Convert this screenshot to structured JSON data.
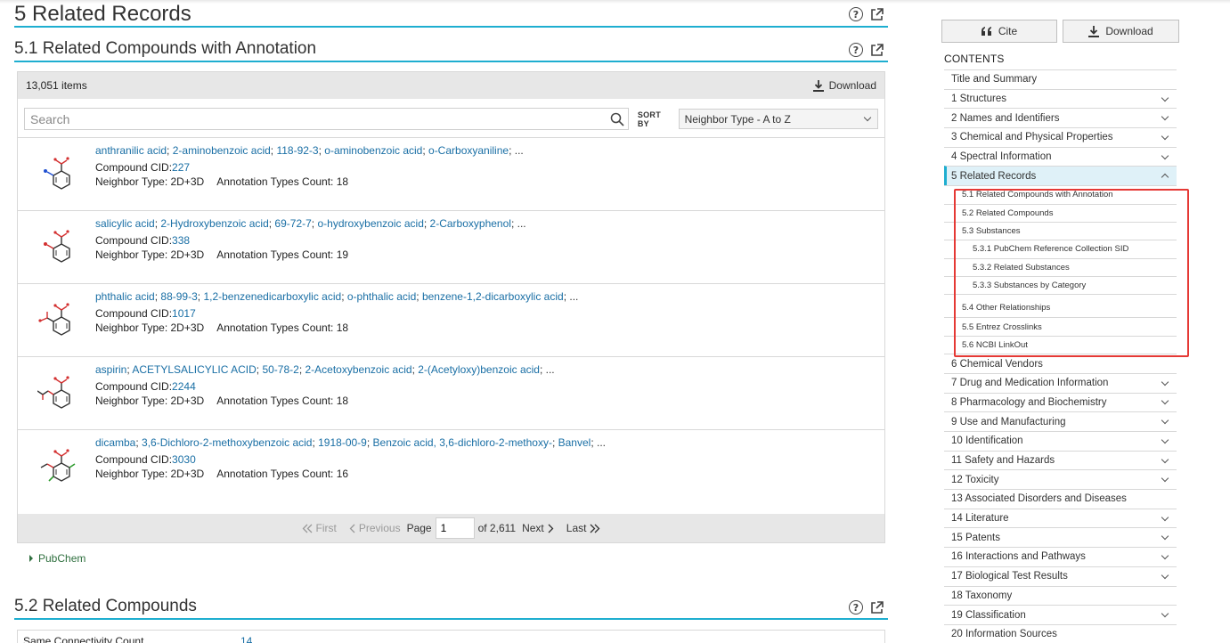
{
  "section5": {
    "title": "5 Related Records"
  },
  "section51": {
    "title": "5.1 Related Compounds with Annotation",
    "count": "13,051 items",
    "download_label": "Download",
    "search_placeholder": "Search",
    "sort_by_label": "SORT BY",
    "sort_value": "Neighbor Type - A to Z",
    "records": [
      {
        "names": [
          "anthranilic acid",
          "2-aminobenzoic acid",
          "118-92-3",
          "o-aminobenzoic acid",
          "o-Carboxyaniline",
          "..."
        ],
        "cid_label": "Compound CID:",
        "cid": "227",
        "neighbor": "Neighbor Type: 2D+3D",
        "annotation": "Annotation Types Count: 18",
        "mol": "nh2"
      },
      {
        "names": [
          "salicylic acid",
          "2-Hydroxybenzoic acid",
          "69-72-7",
          "o-hydroxybenzoic acid",
          "2-Carboxyphenol",
          "..."
        ],
        "cid_label": "Compound CID:",
        "cid": "338",
        "neighbor": "Neighbor Type: 2D+3D",
        "annotation": "Annotation Types Count: 19",
        "mol": "oh"
      },
      {
        "names": [
          "phthalic acid",
          "88-99-3",
          "1,2-benzenedicarboxylic acid",
          "o-phthalic acid",
          "benzene-1,2-dicarboxylic acid",
          "..."
        ],
        "cid_label": "Compound CID:",
        "cid": "1017",
        "neighbor": "Neighbor Type: 2D+3D",
        "annotation": "Annotation Types Count: 18",
        "mol": "cooh"
      },
      {
        "names": [
          "aspirin",
          "ACETYLSALICYLIC ACID",
          "50-78-2",
          "2-Acetoxybenzoic acid",
          "2-(Acetyloxy)benzoic acid",
          "..."
        ],
        "cid_label": "Compound CID:",
        "cid": "2244",
        "neighbor": "Neighbor Type: 2D+3D",
        "annotation": "Annotation Types Count: 18",
        "mol": "oac"
      },
      {
        "names": [
          "dicamba",
          "3,6-Dichloro-2-methoxybenzoic acid",
          "1918-00-9",
          "Benzoic acid, 3,6-dichloro-2-methoxy-",
          "Banvel",
          "..."
        ],
        "cid_label": "Compound CID:",
        "cid": "3030",
        "neighbor": "Neighbor Type: 2D+3D",
        "annotation": "Annotation Types Count: 16",
        "mol": "cl"
      }
    ],
    "pager": {
      "first": "First",
      "previous": "Previous",
      "page_label": "Page",
      "page_value": "1",
      "of_label": "of 2,611",
      "next": "Next",
      "last": "Last"
    },
    "source": "PubChem"
  },
  "section52": {
    "title": "5.2 Related Compounds",
    "row_label": "Same Connectivity Count",
    "row_value": "14"
  },
  "sidebar": {
    "cite_label": "Cite",
    "download_label": "Download",
    "contents_title": "CONTENTS",
    "items_before": [
      {
        "label": "Title and Summary",
        "chevron": false
      },
      {
        "label": "1 Structures",
        "chevron": true
      },
      {
        "label": "2 Names and Identifiers",
        "chevron": true
      },
      {
        "label": "3 Chemical and Physical Properties",
        "chevron": true
      },
      {
        "label": "4 Spectral Information",
        "chevron": true
      }
    ],
    "active_item": "5 Related Records",
    "subitems": [
      {
        "label": "5.1 Related Compounds with Annotation",
        "level": 1
      },
      {
        "label": "5.2 Related Compounds",
        "level": 1
      },
      {
        "label": "5.3 Substances",
        "level": 1
      },
      {
        "label": "5.3.1 PubChem Reference Collection SID",
        "level": 2
      },
      {
        "label": "5.3.2 Related Substances",
        "level": 2
      },
      {
        "label": "5.3.3 Substances by Category",
        "level": 2
      },
      {
        "label": "5.4 Other Relationships",
        "level": 1
      },
      {
        "label": "5.5 Entrez Crosslinks",
        "level": 1
      },
      {
        "label": "5.6 NCBI LinkOut",
        "level": 1
      }
    ],
    "items_after": [
      {
        "label": "6 Chemical Vendors",
        "chevron": false
      },
      {
        "label": "7 Drug and Medication Information",
        "chevron": true
      },
      {
        "label": "8 Pharmacology and Biochemistry",
        "chevron": true
      },
      {
        "label": "9 Use and Manufacturing",
        "chevron": true
      },
      {
        "label": "10 Identification",
        "chevron": true
      },
      {
        "label": "11 Safety and Hazards",
        "chevron": true
      },
      {
        "label": "12 Toxicity",
        "chevron": true
      },
      {
        "label": "13 Associated Disorders and Diseases",
        "chevron": false
      },
      {
        "label": "14 Literature",
        "chevron": true
      },
      {
        "label": "15 Patents",
        "chevron": true
      },
      {
        "label": "16 Interactions and Pathways",
        "chevron": true
      },
      {
        "label": "17 Biological Test Results",
        "chevron": true
      },
      {
        "label": "18 Taxonomy",
        "chevron": false
      },
      {
        "label": "19 Classification",
        "chevron": true
      },
      {
        "label": "20 Information Sources",
        "chevron": false
      }
    ],
    "highlight_color": "#e53935",
    "accent_color": "#1eaed0"
  }
}
